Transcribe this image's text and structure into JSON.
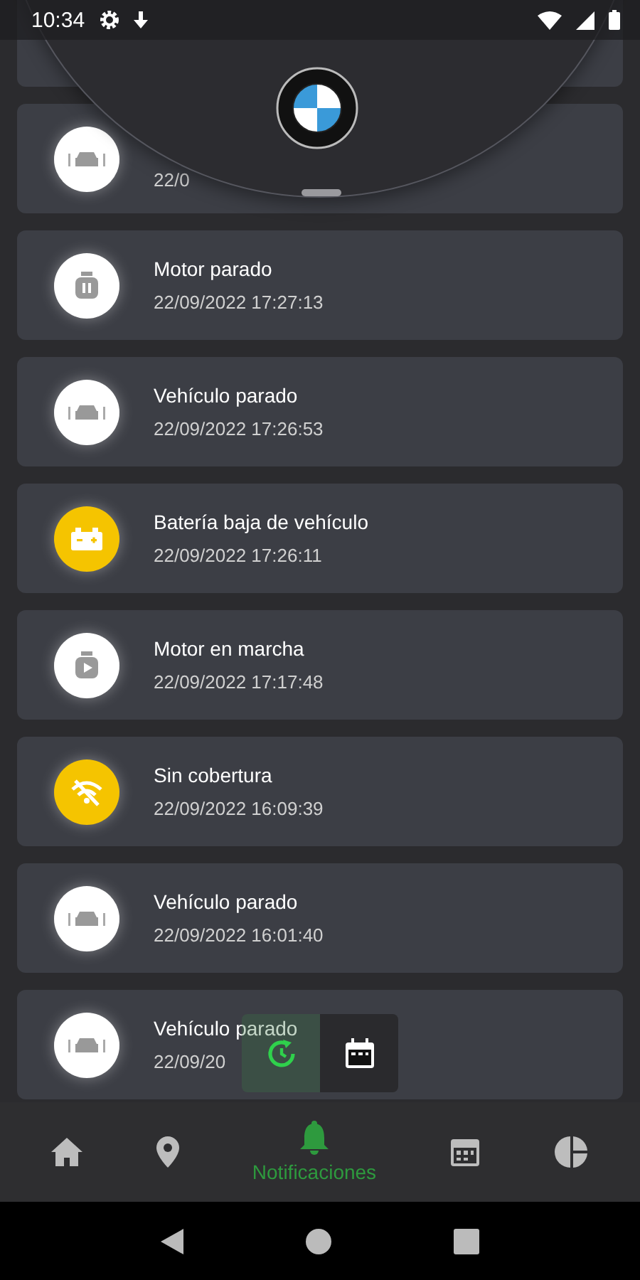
{
  "status_bar": {
    "time": "10:34"
  },
  "notifications": [
    {
      "kind": "car",
      "color": "#ffffff",
      "date": "22/0"
    },
    {
      "kind": "engine-stop",
      "color": "#ffffff",
      "title": "Motor parado",
      "date": "22/09/2022 17:27:13"
    },
    {
      "kind": "car",
      "color": "#ffffff",
      "title": "Vehículo parado",
      "date": "22/09/2022 17:26:53"
    },
    {
      "kind": "battery",
      "color": "#f5c400",
      "title": "Batería baja de vehículo",
      "date": "22/09/2022 17:26:11"
    },
    {
      "kind": "engine-run",
      "color": "#ffffff",
      "title": "Motor en marcha",
      "date": "22/09/2022 17:17:48"
    },
    {
      "kind": "no-signal",
      "color": "#f5c400",
      "title": "Sin cobertura",
      "date": "22/09/2022 16:09:39"
    },
    {
      "kind": "car",
      "color": "#ffffff",
      "title": "Vehículo parado",
      "date": "22/09/2022 16:01:40"
    },
    {
      "kind": "car",
      "color": "#ffffff",
      "title": "Vehículo parado",
      "date": "22/09/20"
    }
  ],
  "nav": [
    {
      "kind": "home",
      "selected": false
    },
    {
      "kind": "location",
      "selected": false
    },
    {
      "kind": "bell",
      "selected": true,
      "label": "Notificaciones"
    },
    {
      "kind": "calendar",
      "selected": false
    },
    {
      "kind": "chart",
      "selected": false
    }
  ]
}
